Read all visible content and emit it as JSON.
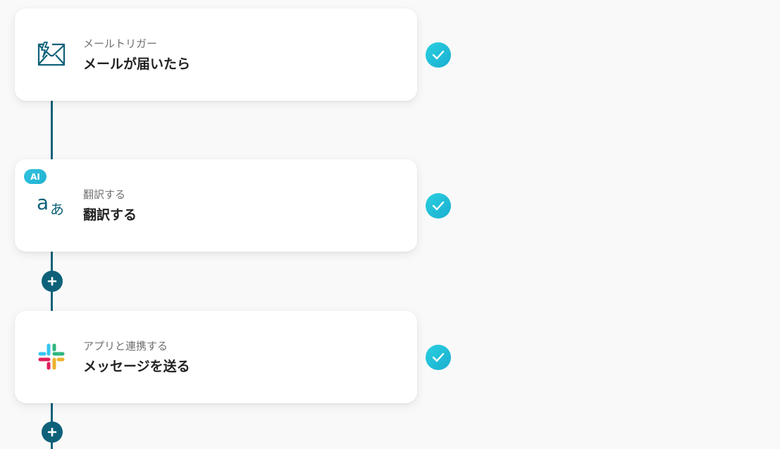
{
  "steps": [
    {
      "subtitle": "メールトリガー",
      "title": "メールが届いたら",
      "icon": "mail-trigger-icon"
    },
    {
      "badge": "AI",
      "subtitle": "翻訳する",
      "title": "翻訳する",
      "icon": "translate-icon"
    },
    {
      "subtitle": "アプリと連携する",
      "title": "メッセージを送る",
      "icon": "slack-icon"
    }
  ],
  "status_icon": "check-icon",
  "add_icon": "plus-icon",
  "colors": {
    "background": "#f9f9fa",
    "connector": "#0e6179",
    "check": "#22c2dc",
    "ai_badge": "#2bbbd8",
    "slack": [
      "#36c5f0",
      "#2eb67d",
      "#ecb22e",
      "#e01e5a"
    ]
  }
}
